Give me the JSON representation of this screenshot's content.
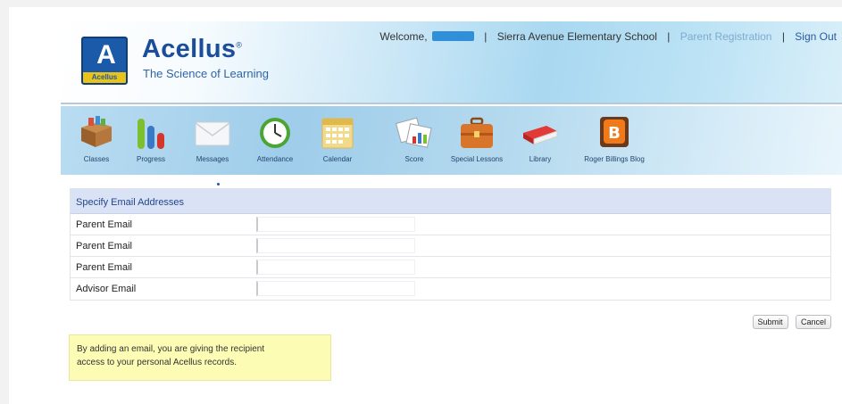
{
  "header": {
    "brand_name": "Acellus",
    "brand_mark": "A",
    "brand_strip": "Acellus",
    "tagline": "The Science of Learning",
    "welcome": "Welcome,",
    "school": "Sierra Avenue Elementary School",
    "parent_registration": "Parent Registration",
    "sign_out": "Sign Out"
  },
  "nav": {
    "items": [
      {
        "label": "Classes",
        "icon": "classes-icon"
      },
      {
        "label": "Progress",
        "icon": "progress-icon"
      },
      {
        "label": "Messages",
        "icon": "messages-icon"
      },
      {
        "label": "Attendance",
        "icon": "attendance-icon"
      },
      {
        "label": "Calendar",
        "icon": "calendar-icon"
      },
      {
        "label": "Score",
        "icon": "score-icon"
      },
      {
        "label": "Special Lessons",
        "icon": "special-lessons-icon"
      },
      {
        "label": "Library",
        "icon": "library-icon"
      },
      {
        "label": "Roger Billings Blog",
        "icon": "blog-icon"
      }
    ]
  },
  "form": {
    "title": "Specify Email Addresses",
    "rows": [
      {
        "label": "Parent Email",
        "value": ""
      },
      {
        "label": "Parent Email",
        "value": ""
      },
      {
        "label": "Parent Email",
        "value": ""
      },
      {
        "label": "Advisor Email",
        "value": ""
      }
    ],
    "submit_label": "Submit",
    "cancel_label": "Cancel"
  },
  "notice": {
    "line1": "By adding an email, you are giving the recipient",
    "line2": "access to your personal Acellus records."
  },
  "colors": {
    "brand_blue": "#1b4d9a",
    "link_blue": "#2a5aa0",
    "form_header_bg": "#d9e3f5",
    "notice_bg": "#fcfcb4",
    "redaction": "#2f8fd8"
  }
}
